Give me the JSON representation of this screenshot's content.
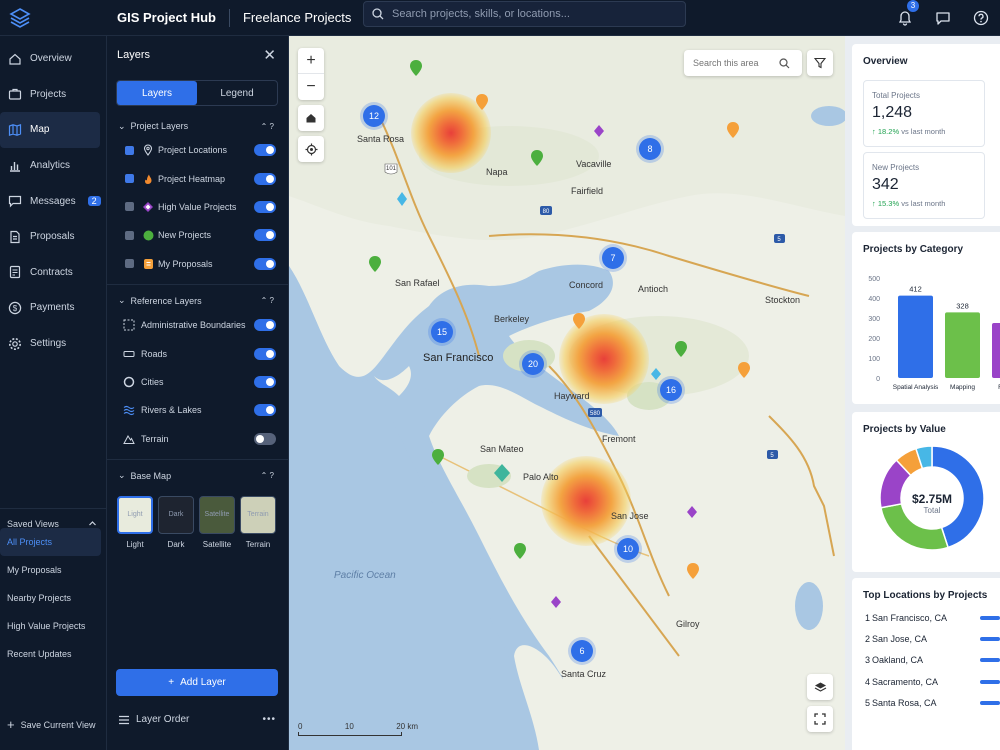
{
  "topbar": {
    "app_title": "GIS Project Hub",
    "workspace_title": "Freelance Projects",
    "search_placeholder": "Search projects, skills, or locations...",
    "notif_count": "3"
  },
  "nav": {
    "items": [
      {
        "label": "Overview",
        "icon": "home-icon"
      },
      {
        "label": "Projects",
        "icon": "briefcase-icon"
      },
      {
        "label": "Map",
        "icon": "map-icon",
        "active": true
      },
      {
        "label": "Analytics",
        "icon": "bar-chart-icon"
      },
      {
        "label": "Messages",
        "icon": "chat-icon",
        "badge": "2"
      },
      {
        "label": "Proposals",
        "icon": "document-icon"
      },
      {
        "label": "Contracts",
        "icon": "contract-icon"
      },
      {
        "label": "Payments",
        "icon": "dollar-icon"
      },
      {
        "label": "Settings",
        "icon": "gear-icon"
      }
    ],
    "saved_views_label": "Saved Views",
    "saved_views": [
      "All Projects",
      "My Proposals",
      "Nearby Projects",
      "High Value Projects",
      "Recent Updates"
    ],
    "save_current_view": "Save Current View"
  },
  "layers_panel": {
    "title": "Layers",
    "tabs": [
      "Layers",
      "Legend"
    ],
    "project_layers_title": "Project Layers",
    "project_layers": [
      {
        "label": "Project Locations",
        "icon": "pin-outline-icon",
        "on": true
      },
      {
        "label": "Project Heatmap",
        "icon": "flame-icon",
        "on": true
      },
      {
        "label": "High Value Projects",
        "icon": "diamond-icon",
        "on": true
      },
      {
        "label": "New Projects",
        "icon": "green-dot-icon",
        "on": true
      },
      {
        "label": "My Proposals",
        "icon": "orange-doc-icon",
        "on": true
      }
    ],
    "reference_layers_title": "Reference Layers",
    "reference_layers": [
      {
        "label": "Administrative Boundaries",
        "icon": "boundary-icon",
        "on": true
      },
      {
        "label": "Roads",
        "icon": "road-icon",
        "on": true
      },
      {
        "label": "Cities",
        "icon": "city-icon",
        "on": true
      },
      {
        "label": "Rivers & Lakes",
        "icon": "water-icon",
        "on": true
      },
      {
        "label": "Terrain",
        "icon": "mountain-icon",
        "on": false
      }
    ],
    "base_map_title": "Base Map",
    "base_maps": [
      {
        "label": "Light",
        "thumb": "Light"
      },
      {
        "label": "Dark",
        "thumb": "Dark"
      },
      {
        "label": "Satellite",
        "thumb": "Satellite"
      },
      {
        "label": "Terrain",
        "thumb": "Terrain"
      }
    ],
    "add_layer": "Add Layer",
    "layer_order": "Layer Order",
    "more": "•••"
  },
  "map": {
    "search_placeholder": "Search this area",
    "cities": [
      "Santa Rosa",
      "Napa",
      "Vacaville",
      "Fairfield",
      "San Rafael",
      "Concord",
      "Antioch",
      "Stockton",
      "Berkeley",
      "San Francisco",
      "Hayward",
      "Fremont",
      "San Mateo",
      "Palo Alto",
      "San Jose",
      "Gilroy",
      "Santa Cruz"
    ],
    "ocean_label": "Pacific Ocean",
    "clusters": [
      "12",
      "8",
      "7",
      "15",
      "20",
      "16",
      "10",
      "6"
    ],
    "highways": [
      "101",
      "80",
      "5",
      "580",
      "5"
    ],
    "scale": [
      "0",
      "10",
      "20 km"
    ]
  },
  "right": {
    "overview_title": "Overview",
    "total_projects": {
      "label": "Total Projects",
      "value": "1,248",
      "delta": "18.2%",
      "suffix": "vs last month"
    },
    "new_projects": {
      "label": "New Projects",
      "value": "342",
      "delta": "15.3%",
      "suffix": "vs last month"
    },
    "category_title": "Projects by Category",
    "value_title": "Projects by Value",
    "donut_value": "$2.75M",
    "donut_label": "Total",
    "locations_title": "Top Locations by Projects",
    "locations": [
      {
        "n": "1",
        "name": "San Francisco, CA"
      },
      {
        "n": "2",
        "name": "San Jose, CA"
      },
      {
        "n": "3",
        "name": "Oakland, CA"
      },
      {
        "n": "4",
        "name": "Sacramento, CA"
      },
      {
        "n": "5",
        "name": "Santa Rosa, CA"
      }
    ]
  },
  "chart_data": [
    {
      "type": "bar",
      "title": "Projects by Category",
      "categories": [
        "Spatial Analysis",
        "Mapping",
        "Remote"
      ],
      "values": [
        412,
        328,
        275
      ],
      "ylim": [
        0,
        500
      ],
      "yticks": [
        0,
        100,
        200,
        300,
        400,
        500
      ],
      "colors": [
        "#2f6fe8",
        "#6cc04a",
        "#9a44c8"
      ]
    },
    {
      "type": "pie",
      "title": "Projects by Value",
      "slices": [
        {
          "value": 45,
          "color": "#2f6fe8"
        },
        {
          "value": 27,
          "color": "#6cc04a"
        },
        {
          "value": 16,
          "color": "#9a44c8"
        },
        {
          "value": 7,
          "color": "#f5a03a"
        },
        {
          "value": 5,
          "color": "#47b7e6"
        }
      ]
    }
  ]
}
